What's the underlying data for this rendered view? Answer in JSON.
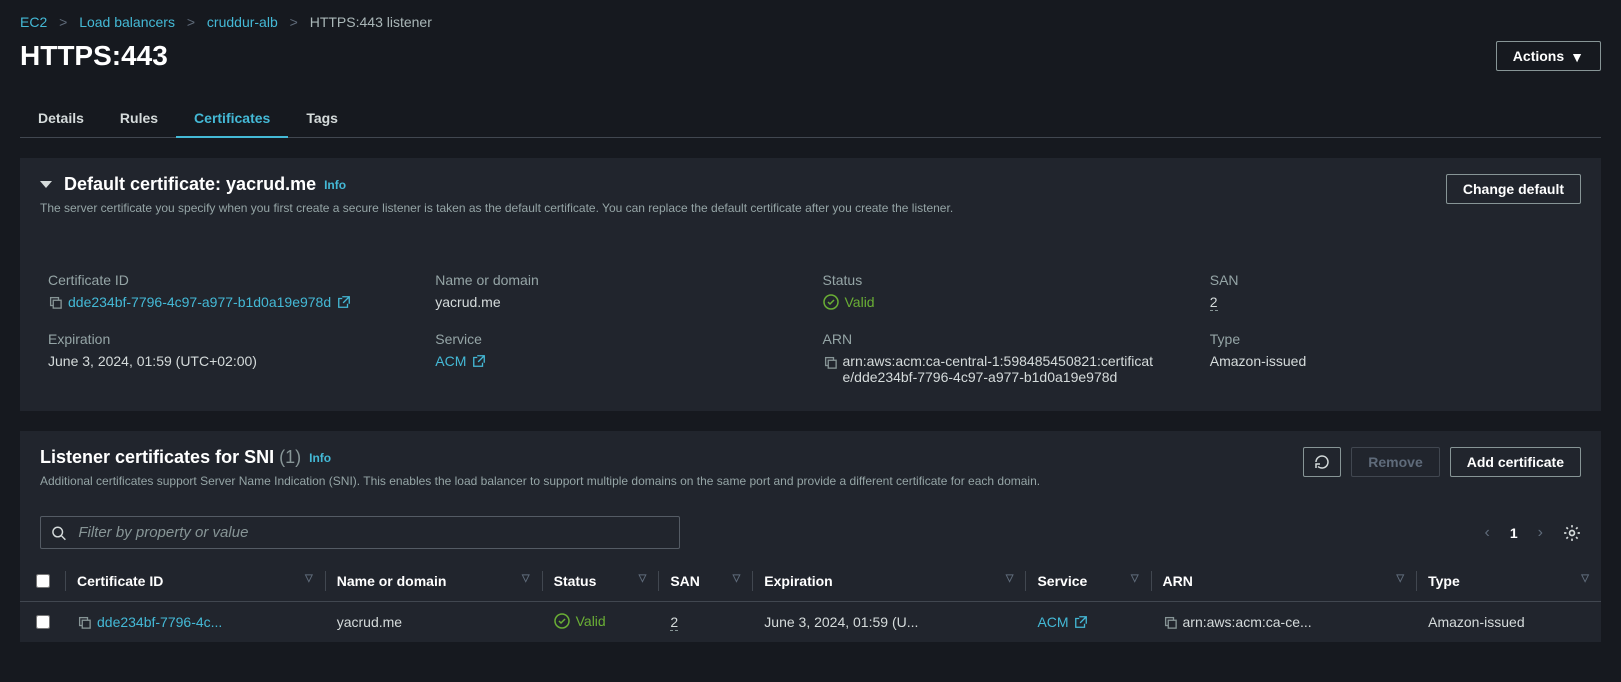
{
  "breadcrumb": {
    "items": [
      "EC2",
      "Load balancers",
      "cruddur-alb"
    ],
    "current": "HTTPS:443 listener"
  },
  "page_title": "HTTPS:443",
  "actions_label": "Actions",
  "tabs": {
    "details": "Details",
    "rules": "Rules",
    "certificates": "Certificates",
    "tags": "Tags"
  },
  "default_cert": {
    "heading_prefix": "Default certificate: ",
    "heading_domain": "yacrud.me",
    "info": "Info",
    "change_btn": "Change default",
    "desc": "The server certificate you specify when you first create a secure listener is taken as the default certificate. You can replace the default certificate after you create the listener.",
    "labels": {
      "cert_id": "Certificate ID",
      "name": "Name or domain",
      "status": "Status",
      "san": "SAN",
      "expiration": "Expiration",
      "service": "Service",
      "arn": "ARN",
      "type": "Type"
    },
    "values": {
      "cert_id": "dde234bf-7796-4c97-a977-b1d0a19e978d",
      "name": "yacrud.me",
      "status": "Valid",
      "san": "2",
      "expiration": "June 3, 2024, 01:59 (UTC+02:00)",
      "service": "ACM",
      "arn": "arn:aws:acm:ca-central-1:598485450821:certificate/dde234bf-7796-4c97-a977-b1d0a19e978d",
      "type": "Amazon-issued"
    }
  },
  "sni": {
    "heading": "Listener certificates for SNI",
    "count": "(1)",
    "info": "Info",
    "desc": "Additional certificates support Server Name Indication (SNI). This enables the load balancer to support multiple domains on the same port and provide a different certificate for each domain.",
    "remove_btn": "Remove",
    "add_btn": "Add certificate",
    "filter_placeholder": "Filter by property or value",
    "page": "1",
    "columns": {
      "cert_id": "Certificate ID",
      "name": "Name or domain",
      "status": "Status",
      "san": "SAN",
      "expiration": "Expiration",
      "service": "Service",
      "arn": "ARN",
      "type": "Type"
    },
    "rows": [
      {
        "cert_id": "dde234bf-7796-4c...",
        "name": "yacrud.me",
        "status": "Valid",
        "san": "2",
        "expiration": "June 3, 2024, 01:59 (U...",
        "service": "ACM",
        "arn": "arn:aws:acm:ca-ce...",
        "type": "Amazon-issued"
      }
    ]
  }
}
